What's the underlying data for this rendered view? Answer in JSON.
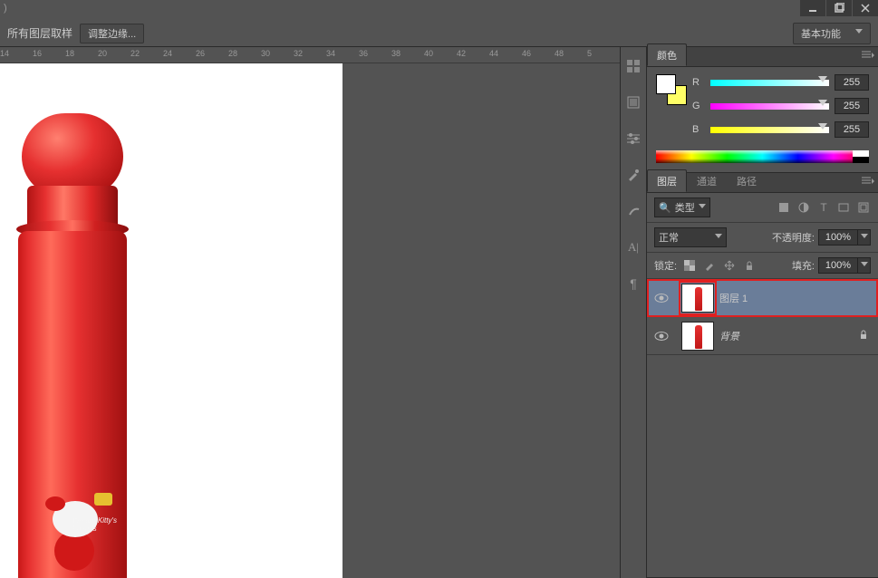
{
  "titlebar": {
    "hint": ")"
  },
  "windowControls": {
    "min": "–",
    "max": "❐",
    "close": "✕"
  },
  "options": {
    "sampleText": "所有图层取样",
    "refineEdge": "调整边缘...",
    "workspace": "基本功能"
  },
  "ruler": [
    "14",
    "16",
    "18",
    "20",
    "22",
    "24",
    "26",
    "28",
    "30",
    "32",
    "34",
    "36",
    "38",
    "40",
    "42",
    "44",
    "46",
    "48",
    "5"
  ],
  "colorPanel": {
    "tab": "颜色",
    "fg": "#ffffff",
    "bg": "#ffff66",
    "channels": [
      {
        "label": "R",
        "value": "255"
      },
      {
        "label": "G",
        "value": "255"
      },
      {
        "label": "B",
        "value": "255"
      }
    ]
  },
  "stripIcons": [
    "swatches-icon",
    "styles-icon",
    "adjustments-icon",
    "brush-icon",
    "brush-preset-icon",
    "character-icon",
    "paragraph-icon"
  ],
  "layersPanel": {
    "tabs": [
      "图层",
      "通道",
      "路径"
    ],
    "kindLabel": "类型",
    "search": "🔍",
    "blend": "正常",
    "opacityLabel": "不透明度:",
    "opacityVal": "100%",
    "lockLabel": "锁定:",
    "fillLabel": "填充:",
    "fillVal": "100%",
    "layers": [
      {
        "name": "图层 1",
        "selected": true,
        "highlighted": true,
        "locked": false
      },
      {
        "name": "背景",
        "selected": false,
        "highlighted": false,
        "locked": true,
        "italic": true
      }
    ]
  },
  "decoration": {
    "hkText": "We are Kitty's Friends"
  }
}
